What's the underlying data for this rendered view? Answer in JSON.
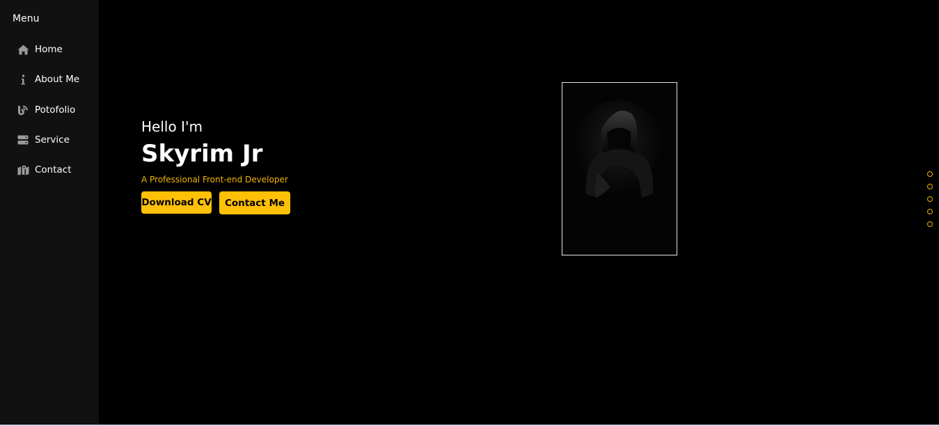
{
  "sidebar": {
    "title": "Menu",
    "items": [
      {
        "label": "Home",
        "icon": "home-icon"
      },
      {
        "label": "About Me",
        "icon": "info-icon"
      },
      {
        "label": "Potofolio",
        "icon": "blog-icon"
      },
      {
        "label": "Service",
        "icon": "server-icon"
      },
      {
        "label": "Contact",
        "icon": "map-icon"
      }
    ]
  },
  "hero": {
    "greeting": "Hello I'm",
    "name": "Skyrim Jr",
    "tagline": "A Professional Front-end Developer",
    "download_label": "Download CV",
    "contact_label": "Contact Me"
  },
  "colors": {
    "accent": "#ffc107",
    "tagline": "#f6b400",
    "background": "#000000",
    "sidebar": "#111111",
    "icon": "#9a9a9a"
  },
  "section_dots": {
    "count": 5
  }
}
